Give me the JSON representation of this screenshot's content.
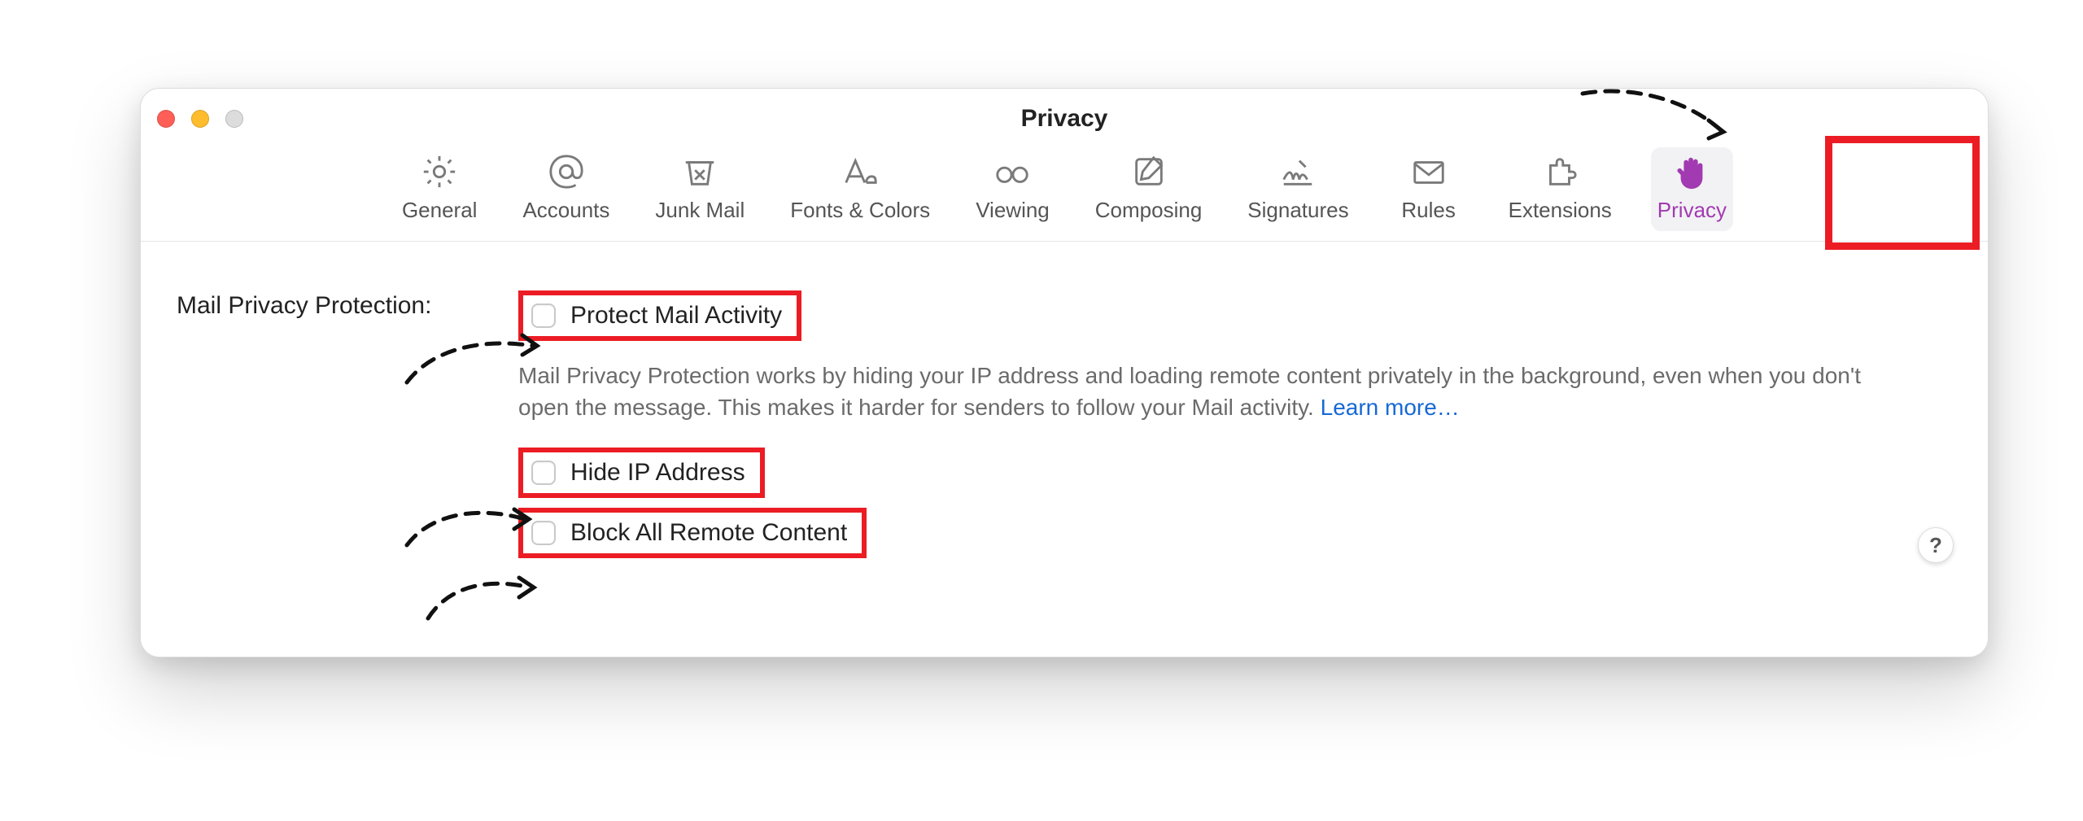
{
  "window": {
    "title": "Privacy"
  },
  "tabs": [
    {
      "id": "general",
      "label": "General"
    },
    {
      "id": "accounts",
      "label": "Accounts"
    },
    {
      "id": "junk",
      "label": "Junk Mail"
    },
    {
      "id": "fonts",
      "label": "Fonts & Colors"
    },
    {
      "id": "viewing",
      "label": "Viewing"
    },
    {
      "id": "composing",
      "label": "Composing"
    },
    {
      "id": "signatures",
      "label": "Signatures"
    },
    {
      "id": "rules",
      "label": "Rules"
    },
    {
      "id": "extensions",
      "label": "Extensions"
    },
    {
      "id": "privacy",
      "label": "Privacy",
      "active": true
    }
  ],
  "section": {
    "label": "Mail Privacy Protection:"
  },
  "options": {
    "protect": {
      "label": "Protect Mail Activity",
      "checked": false
    },
    "hideip": {
      "label": "Hide IP Address",
      "checked": false
    },
    "blockremote": {
      "label": "Block All Remote Content",
      "checked": false
    }
  },
  "description": "Mail Privacy Protection works by hiding your IP address and loading remote content privately in the background, even when you don't open the message. This makes it harder for senders to follow your Mail activity. ",
  "learn_more": "Learn more…",
  "help": "?"
}
